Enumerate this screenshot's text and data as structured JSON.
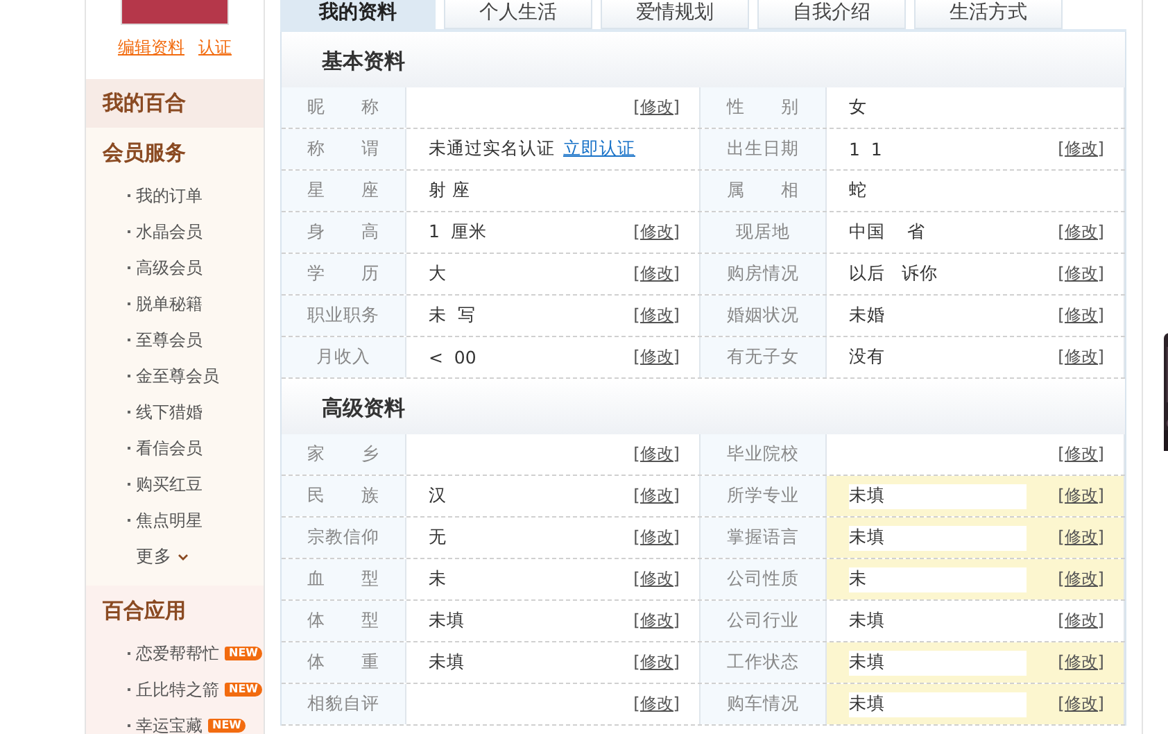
{
  "sidebar": {
    "profile_links": [
      "编辑资料",
      "认证"
    ],
    "home": "我的百合",
    "sections": [
      {
        "title": "会员服务",
        "items": [
          {
            "label": "我的订单"
          },
          {
            "label": "水晶会员"
          },
          {
            "label": "高级会员"
          },
          {
            "label": "脱单秘籍"
          },
          {
            "label": "至尊会员"
          },
          {
            "label": "金至尊会员"
          },
          {
            "label": "线下猎婚"
          },
          {
            "label": "看信会员"
          },
          {
            "label": "购买红豆"
          },
          {
            "label": "焦点明星"
          }
        ],
        "more": "更多"
      },
      {
        "title": "百合应用",
        "items": [
          {
            "label": "恋爱帮帮忙",
            "badge": "NEW"
          },
          {
            "label": "丘比特之箭",
            "badge": "NEW"
          },
          {
            "label": "幸运宝藏",
            "badge": "NEW"
          }
        ]
      }
    ]
  },
  "tabs": [
    {
      "label": "我的资料",
      "selected": true
    },
    {
      "label": "个人生活",
      "selected": false
    },
    {
      "label": "爱情规划",
      "selected": false
    },
    {
      "label": "自我介绍",
      "selected": false
    },
    {
      "label": "生活方式",
      "selected": false
    }
  ],
  "sections": [
    {
      "title": "基本资料",
      "rows": [
        {
          "left": {
            "label": "昵　　称",
            "edit": "[修改]"
          },
          "right": {
            "label": "性　　别",
            "value": "女"
          }
        },
        {
          "left": {
            "label": "称　　谓",
            "value": "未通过实名认证",
            "link": "立即认证"
          },
          "right": {
            "label": "出生日期",
            "value": "1  1",
            "edit": "[修改]"
          }
        },
        {
          "left": {
            "label": "星　　座",
            "value": "射 座"
          },
          "right": {
            "label": "属　　相",
            "value": "蛇"
          }
        },
        {
          "left": {
            "label": "身　　高",
            "value": "1  厘米",
            "edit": "[修改]"
          },
          "right": {
            "label": "现居地",
            "value": "中国    省",
            "edit": "[修改]"
          }
        },
        {
          "left": {
            "label": "学　　历",
            "value": "大",
            "edit": "[修改]"
          },
          "right": {
            "label": "购房情况",
            "value": "以后   诉你",
            "edit": "[修改]"
          }
        },
        {
          "left": {
            "label": "职业职务",
            "value": "未  写",
            "edit": "[修改]"
          },
          "right": {
            "label": "婚姻状况",
            "value": "未婚",
            "edit": "[修改]"
          }
        },
        {
          "left": {
            "label": "月收入",
            "value": "<  00",
            "edit": "[修改]"
          },
          "right": {
            "label": "有无子女",
            "value": "没有",
            "edit": "[修改]"
          }
        }
      ]
    },
    {
      "title": "高级资料",
      "rows": [
        {
          "left": {
            "label": "家　　乡",
            "edit": "[修改]"
          },
          "right": {
            "label": "毕业院校",
            "edit": "[修改]",
            "highlighted": false
          }
        },
        {
          "left": {
            "label": "民　　族",
            "value": "汉",
            "edit": "[修改]"
          },
          "right": {
            "label": "所学专业",
            "value": "未填",
            "edit": "[修改]",
            "highlighted": true
          }
        },
        {
          "left": {
            "label": "宗教信仰",
            "value": "无",
            "edit": "[修改]"
          },
          "right": {
            "label": "掌握语言",
            "value": "未填",
            "edit": "[修改]",
            "highlighted": true
          }
        },
        {
          "left": {
            "label": "血　　型",
            "value": "未",
            "edit": "[修改]"
          },
          "right": {
            "label": "公司性质",
            "value": "未",
            "edit": "[修改]",
            "highlighted": true
          }
        },
        {
          "left": {
            "label": "体　　型",
            "value": "未填",
            "edit": "[修改]"
          },
          "right": {
            "label": "公司行业",
            "value": "未填",
            "edit": "[修改]",
            "highlighted": false
          }
        },
        {
          "left": {
            "label": "体　　重",
            "value": "未填",
            "edit": "[修改]"
          },
          "right": {
            "label": "工作状态",
            "value": "未填",
            "edit": "[修改]",
            "highlighted": true
          }
        },
        {
          "left": {
            "label": "相貌自评",
            "edit": "[修改]"
          },
          "right": {
            "label": "购车情况",
            "value": "未填",
            "edit": "[修改]",
            "highlighted": true
          }
        }
      ]
    }
  ]
}
